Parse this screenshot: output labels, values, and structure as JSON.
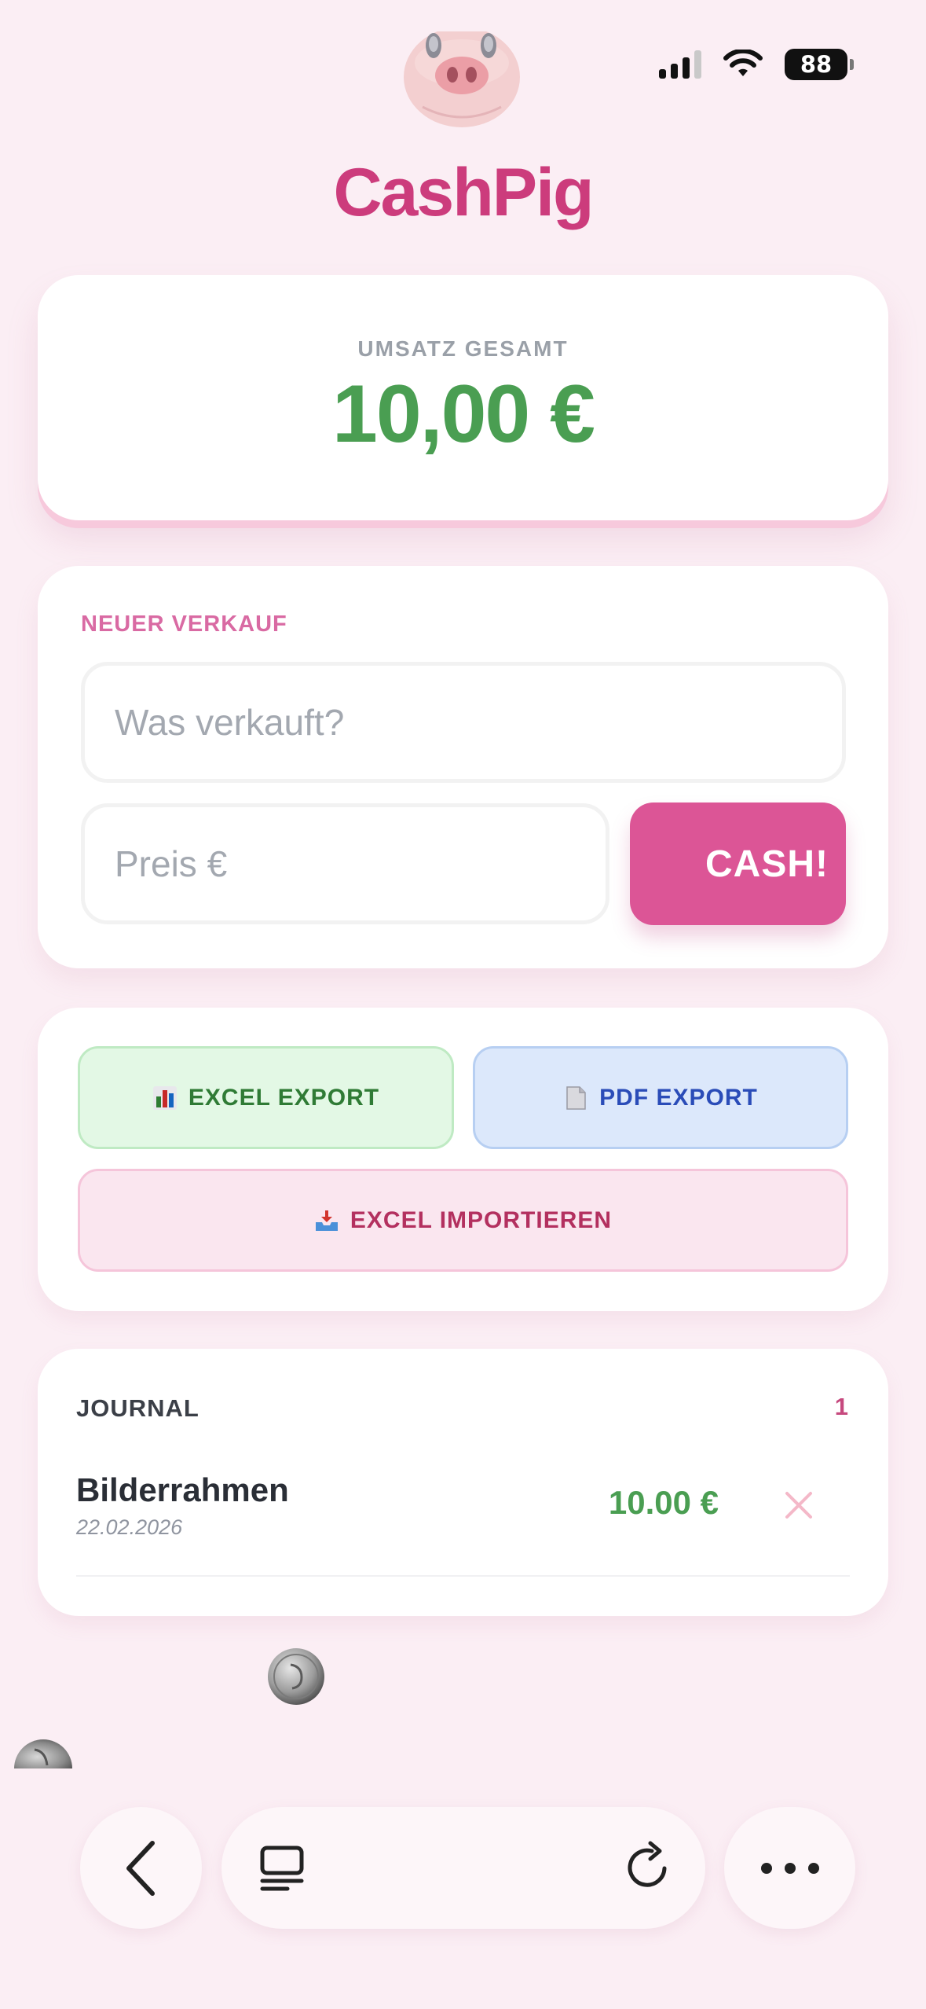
{
  "status_bar": {
    "battery": "88"
  },
  "app": {
    "title": "CashPig",
    "accent": "#cc3c7c"
  },
  "total": {
    "label": "UMSATZ GESAMT",
    "value": "10,00 €",
    "color": "#4a9e52"
  },
  "new_sale": {
    "label": "NEUER VERKAUF",
    "item_placeholder": "Was verkauft?",
    "price_placeholder": "Preis €",
    "submit_label": "CASH!"
  },
  "actions": {
    "excel_export": "EXCEL EXPORT",
    "pdf_export": "PDF EXPORT",
    "excel_import": "EXCEL IMPORTIEREN"
  },
  "journal": {
    "label": "JOURNAL",
    "count": "1",
    "entries": [
      {
        "name": "Bilderrahmen",
        "date": "22.02.2026",
        "amount": "10.00 €"
      }
    ]
  },
  "browser": {
    "buttons": [
      "back-icon",
      "tabs-icon",
      "reload-icon",
      "more-icon"
    ]
  }
}
